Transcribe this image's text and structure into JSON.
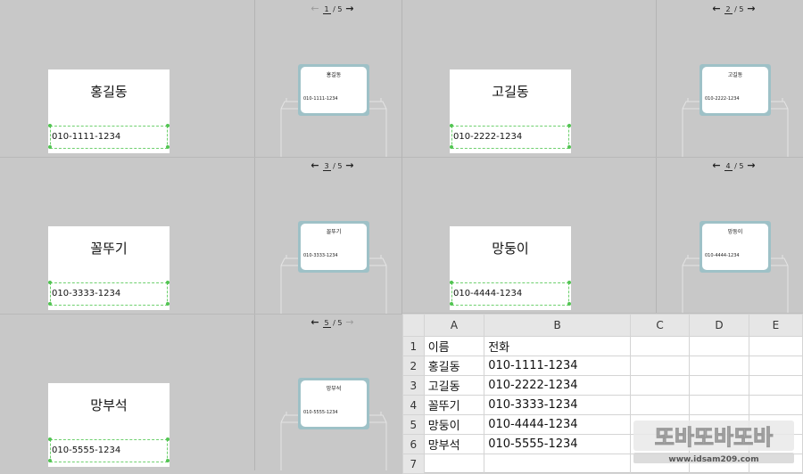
{
  "pager_total": "5",
  "panels": [
    {
      "name": "홍길동",
      "phone": "010-1111-1234",
      "page": "1",
      "prev_enabled": false,
      "next_enabled": true
    },
    {
      "name": "고길동",
      "phone": "010-2222-1234",
      "page": "2",
      "prev_enabled": true,
      "next_enabled": true
    },
    {
      "name": "꼴뚜기",
      "phone": "010-3333-1234",
      "page": "3",
      "prev_enabled": true,
      "next_enabled": true
    },
    {
      "name": "망둥이",
      "phone": "010-4444-1234",
      "page": "4",
      "prev_enabled": true,
      "next_enabled": true
    },
    {
      "name": "망부석",
      "phone": "010-5555-1234",
      "page": "5",
      "prev_enabled": true,
      "next_enabled": false
    }
  ],
  "spreadsheet": {
    "columns": [
      "A",
      "B",
      "C",
      "D",
      "E"
    ],
    "rows": [
      {
        "num": "1",
        "a": "이름",
        "b": "전화"
      },
      {
        "num": "2",
        "a": "홍길동",
        "b": "010-1111-1234"
      },
      {
        "num": "3",
        "a": "고길동",
        "b": "010-2222-1234"
      },
      {
        "num": "4",
        "a": "꼴뚜기",
        "b": "010-3333-1234"
      },
      {
        "num": "5",
        "a": "망둥이",
        "b": "010-4444-1234"
      },
      {
        "num": "6",
        "a": "망부석",
        "b": "010-5555-1234"
      },
      {
        "num": "7",
        "a": "",
        "b": ""
      }
    ]
  },
  "watermark": {
    "text": "www.idsam209.com",
    "logo_glyphs": "또바또바또바"
  },
  "colors": {
    "preview_frame": "#9ec1c7",
    "selection": "#6ed06e",
    "background": "#c8c8c8"
  }
}
